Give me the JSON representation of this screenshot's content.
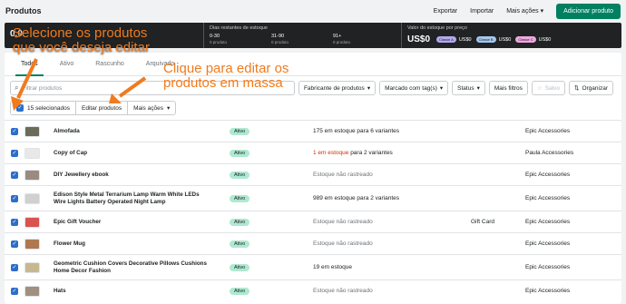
{
  "header": {
    "title": "Produtos",
    "export": "Exportar",
    "import": "Importar",
    "more_actions": "Mais ações",
    "add_product": "Adicionar produto"
  },
  "stats": {
    "days": {
      "label": "Dias restantes de estoque",
      "ranges": [
        {
          "label": "0-30",
          "value": "0 produto"
        },
        {
          "label": "31-90",
          "value": "0 produto"
        },
        {
          "label": "91+",
          "value": "0 produto"
        }
      ]
    },
    "value": {
      "label": "Valor do estoque por preço",
      "total": "US$0",
      "chips": [
        {
          "label": "Classe A",
          "value": "US$0",
          "color": "#b4a8f0"
        },
        {
          "label": "Classe B",
          "value": "US$0",
          "color": "#a4c8f0"
        },
        {
          "label": "Classe C",
          "value": "US$0",
          "color": "#f0a8e0"
        }
      ]
    },
    "left_value": "0,0"
  },
  "tabs": [
    "Todos",
    "Ativo",
    "Rascunho",
    "Arquivado"
  ],
  "filters": {
    "search_placeholder": "Filtrar produtos",
    "vendor": "Fabricante de produtos",
    "tags": "Marcado com tag(s)",
    "status": "Status",
    "more": "Mais filtros",
    "save": "Salvo",
    "sort": "Organizar"
  },
  "bulk": {
    "selected": "15 selecionados",
    "edit": "Editar produtos",
    "more_actions": "Mais ações"
  },
  "products": [
    {
      "name": "Almofada",
      "status": "Ativo",
      "inventory_plain": "175 em estoque para 6 variantes",
      "inventory_red": "",
      "inventory_suffix": "",
      "muted": false,
      "type": "",
      "vendor": "Epic Accessories",
      "thumb": "#6b6b5a"
    },
    {
      "name": "Copy of Cap",
      "status": "Ativo",
      "inventory_plain": "",
      "inventory_red": "1 em estoque",
      "inventory_suffix": " para 2 variantes",
      "muted": false,
      "type": "",
      "vendor": "Paula Accessories",
      "thumb": "#e8e8e8"
    },
    {
      "name": "DIY Jewellery ebook",
      "status": "Ativo",
      "inventory_plain": "Estoque não rastreado",
      "inventory_red": "",
      "inventory_suffix": "",
      "muted": true,
      "type": "",
      "vendor": "Epic Accessories",
      "thumb": "#9a8a80"
    },
    {
      "name": "Edison Style Metal Terrarium Lamp Warm White LEDs Wire Lights Battery Operated Night Lamp",
      "status": "Ativo",
      "inventory_plain": "989 em estoque para 2 variantes",
      "inventory_red": "",
      "inventory_suffix": "",
      "muted": false,
      "type": "",
      "vendor": "Epic Accessories",
      "thumb": "#d0d0d0"
    },
    {
      "name": "Epic Gift Voucher",
      "status": "Ativo",
      "inventory_plain": "Estoque não rastreado",
      "inventory_red": "",
      "inventory_suffix": "",
      "muted": true,
      "type": "Gift Card",
      "vendor": "Epic Accessories",
      "thumb": "#d9534f"
    },
    {
      "name": "Flower Mug",
      "status": "Ativo",
      "inventory_plain": "Estoque não rastreado",
      "inventory_red": "",
      "inventory_suffix": "",
      "muted": true,
      "type": "",
      "vendor": "Epic Accessories",
      "thumb": "#b07850"
    },
    {
      "name": "Geometric Cushion Covers Decorative Pillows Cushions Home Decor Fashion",
      "status": "Ativo",
      "inventory_plain": "19 em estoque",
      "inventory_red": "",
      "inventory_suffix": "",
      "muted": false,
      "type": "",
      "vendor": "Epic Accessories",
      "thumb": "#c8b890"
    },
    {
      "name": "Hats",
      "status": "Ativo",
      "inventory_plain": "Estoque não rastreado",
      "inventory_red": "",
      "inventory_suffix": "",
      "muted": true,
      "type": "",
      "vendor": "Epic Accessories",
      "thumb": "#a09080"
    }
  ],
  "annotations": {
    "select_line1": "Selecione os produtos",
    "select_line2": "que você deseja editar",
    "edit_line1": "Clique para editar os",
    "edit_line2": "produtos em massa"
  }
}
